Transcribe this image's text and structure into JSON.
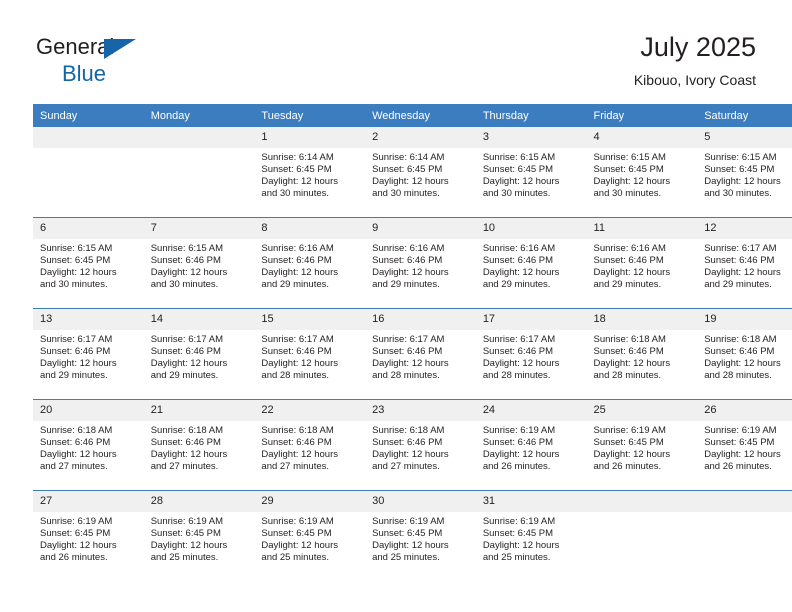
{
  "brand": {
    "name_top": "General",
    "name_bottom": "Blue",
    "triangle_color": "#1565a8",
    "text_color": "#231f20"
  },
  "header": {
    "title": "July 2025",
    "subtitle": "Kibouo, Ivory Coast"
  },
  "theme": {
    "header_bg": "#3b7dbf",
    "header_text": "#ffffff",
    "daynum_bg": "#f0f0f0",
    "cell_bg": "#ffffff",
    "rule_color": "#3b7dbf",
    "body_text": "#231f20"
  },
  "weekdays": [
    "Sunday",
    "Monday",
    "Tuesday",
    "Wednesday",
    "Thursday",
    "Friday",
    "Saturday"
  ],
  "labels": {
    "sunrise_prefix": "Sunrise:",
    "sunset_prefix": "Sunset:",
    "daylight_prefix": "Daylight:"
  },
  "weeks": [
    [
      {
        "day": "",
        "empty": true
      },
      {
        "day": "",
        "empty": true
      },
      {
        "day": "1",
        "sunrise": "Sunrise: 6:14 AM",
        "sunset": "Sunset: 6:45 PM",
        "daylight_l1": "Daylight: 12 hours",
        "daylight_l2": "and 30 minutes."
      },
      {
        "day": "2",
        "sunrise": "Sunrise: 6:14 AM",
        "sunset": "Sunset: 6:45 PM",
        "daylight_l1": "Daylight: 12 hours",
        "daylight_l2": "and 30 minutes."
      },
      {
        "day": "3",
        "sunrise": "Sunrise: 6:15 AM",
        "sunset": "Sunset: 6:45 PM",
        "daylight_l1": "Daylight: 12 hours",
        "daylight_l2": "and 30 minutes."
      },
      {
        "day": "4",
        "sunrise": "Sunrise: 6:15 AM",
        "sunset": "Sunset: 6:45 PM",
        "daylight_l1": "Daylight: 12 hours",
        "daylight_l2": "and 30 minutes."
      },
      {
        "day": "5",
        "sunrise": "Sunrise: 6:15 AM",
        "sunset": "Sunset: 6:45 PM",
        "daylight_l1": "Daylight: 12 hours",
        "daylight_l2": "and 30 minutes."
      }
    ],
    [
      {
        "day": "6",
        "sunrise": "Sunrise: 6:15 AM",
        "sunset": "Sunset: 6:45 PM",
        "daylight_l1": "Daylight: 12 hours",
        "daylight_l2": "and 30 minutes."
      },
      {
        "day": "7",
        "sunrise": "Sunrise: 6:15 AM",
        "sunset": "Sunset: 6:46 PM",
        "daylight_l1": "Daylight: 12 hours",
        "daylight_l2": "and 30 minutes."
      },
      {
        "day": "8",
        "sunrise": "Sunrise: 6:16 AM",
        "sunset": "Sunset: 6:46 PM",
        "daylight_l1": "Daylight: 12 hours",
        "daylight_l2": "and 29 minutes."
      },
      {
        "day": "9",
        "sunrise": "Sunrise: 6:16 AM",
        "sunset": "Sunset: 6:46 PM",
        "daylight_l1": "Daylight: 12 hours",
        "daylight_l2": "and 29 minutes."
      },
      {
        "day": "10",
        "sunrise": "Sunrise: 6:16 AM",
        "sunset": "Sunset: 6:46 PM",
        "daylight_l1": "Daylight: 12 hours",
        "daylight_l2": "and 29 minutes."
      },
      {
        "day": "11",
        "sunrise": "Sunrise: 6:16 AM",
        "sunset": "Sunset: 6:46 PM",
        "daylight_l1": "Daylight: 12 hours",
        "daylight_l2": "and 29 minutes."
      },
      {
        "day": "12",
        "sunrise": "Sunrise: 6:17 AM",
        "sunset": "Sunset: 6:46 PM",
        "daylight_l1": "Daylight: 12 hours",
        "daylight_l2": "and 29 minutes."
      }
    ],
    [
      {
        "day": "13",
        "sunrise": "Sunrise: 6:17 AM",
        "sunset": "Sunset: 6:46 PM",
        "daylight_l1": "Daylight: 12 hours",
        "daylight_l2": "and 29 minutes."
      },
      {
        "day": "14",
        "sunrise": "Sunrise: 6:17 AM",
        "sunset": "Sunset: 6:46 PM",
        "daylight_l1": "Daylight: 12 hours",
        "daylight_l2": "and 29 minutes."
      },
      {
        "day": "15",
        "sunrise": "Sunrise: 6:17 AM",
        "sunset": "Sunset: 6:46 PM",
        "daylight_l1": "Daylight: 12 hours",
        "daylight_l2": "and 28 minutes."
      },
      {
        "day": "16",
        "sunrise": "Sunrise: 6:17 AM",
        "sunset": "Sunset: 6:46 PM",
        "daylight_l1": "Daylight: 12 hours",
        "daylight_l2": "and 28 minutes."
      },
      {
        "day": "17",
        "sunrise": "Sunrise: 6:17 AM",
        "sunset": "Sunset: 6:46 PM",
        "daylight_l1": "Daylight: 12 hours",
        "daylight_l2": "and 28 minutes."
      },
      {
        "day": "18",
        "sunrise": "Sunrise: 6:18 AM",
        "sunset": "Sunset: 6:46 PM",
        "daylight_l1": "Daylight: 12 hours",
        "daylight_l2": "and 28 minutes."
      },
      {
        "day": "19",
        "sunrise": "Sunrise: 6:18 AM",
        "sunset": "Sunset: 6:46 PM",
        "daylight_l1": "Daylight: 12 hours",
        "daylight_l2": "and 28 minutes."
      }
    ],
    [
      {
        "day": "20",
        "sunrise": "Sunrise: 6:18 AM",
        "sunset": "Sunset: 6:46 PM",
        "daylight_l1": "Daylight: 12 hours",
        "daylight_l2": "and 27 minutes."
      },
      {
        "day": "21",
        "sunrise": "Sunrise: 6:18 AM",
        "sunset": "Sunset: 6:46 PM",
        "daylight_l1": "Daylight: 12 hours",
        "daylight_l2": "and 27 minutes."
      },
      {
        "day": "22",
        "sunrise": "Sunrise: 6:18 AM",
        "sunset": "Sunset: 6:46 PM",
        "daylight_l1": "Daylight: 12 hours",
        "daylight_l2": "and 27 minutes."
      },
      {
        "day": "23",
        "sunrise": "Sunrise: 6:18 AM",
        "sunset": "Sunset: 6:46 PM",
        "daylight_l1": "Daylight: 12 hours",
        "daylight_l2": "and 27 minutes."
      },
      {
        "day": "24",
        "sunrise": "Sunrise: 6:19 AM",
        "sunset": "Sunset: 6:46 PM",
        "daylight_l1": "Daylight: 12 hours",
        "daylight_l2": "and 26 minutes."
      },
      {
        "day": "25",
        "sunrise": "Sunrise: 6:19 AM",
        "sunset": "Sunset: 6:45 PM",
        "daylight_l1": "Daylight: 12 hours",
        "daylight_l2": "and 26 minutes."
      },
      {
        "day": "26",
        "sunrise": "Sunrise: 6:19 AM",
        "sunset": "Sunset: 6:45 PM",
        "daylight_l1": "Daylight: 12 hours",
        "daylight_l2": "and 26 minutes."
      }
    ],
    [
      {
        "day": "27",
        "sunrise": "Sunrise: 6:19 AM",
        "sunset": "Sunset: 6:45 PM",
        "daylight_l1": "Daylight: 12 hours",
        "daylight_l2": "and 26 minutes."
      },
      {
        "day": "28",
        "sunrise": "Sunrise: 6:19 AM",
        "sunset": "Sunset: 6:45 PM",
        "daylight_l1": "Daylight: 12 hours",
        "daylight_l2": "and 25 minutes."
      },
      {
        "day": "29",
        "sunrise": "Sunrise: 6:19 AM",
        "sunset": "Sunset: 6:45 PM",
        "daylight_l1": "Daylight: 12 hours",
        "daylight_l2": "and 25 minutes."
      },
      {
        "day": "30",
        "sunrise": "Sunrise: 6:19 AM",
        "sunset": "Sunset: 6:45 PM",
        "daylight_l1": "Daylight: 12 hours",
        "daylight_l2": "and 25 minutes."
      },
      {
        "day": "31",
        "sunrise": "Sunrise: 6:19 AM",
        "sunset": "Sunset: 6:45 PM",
        "daylight_l1": "Daylight: 12 hours",
        "daylight_l2": "and 25 minutes."
      },
      {
        "day": "",
        "empty": true
      },
      {
        "day": "",
        "empty": true
      }
    ]
  ]
}
